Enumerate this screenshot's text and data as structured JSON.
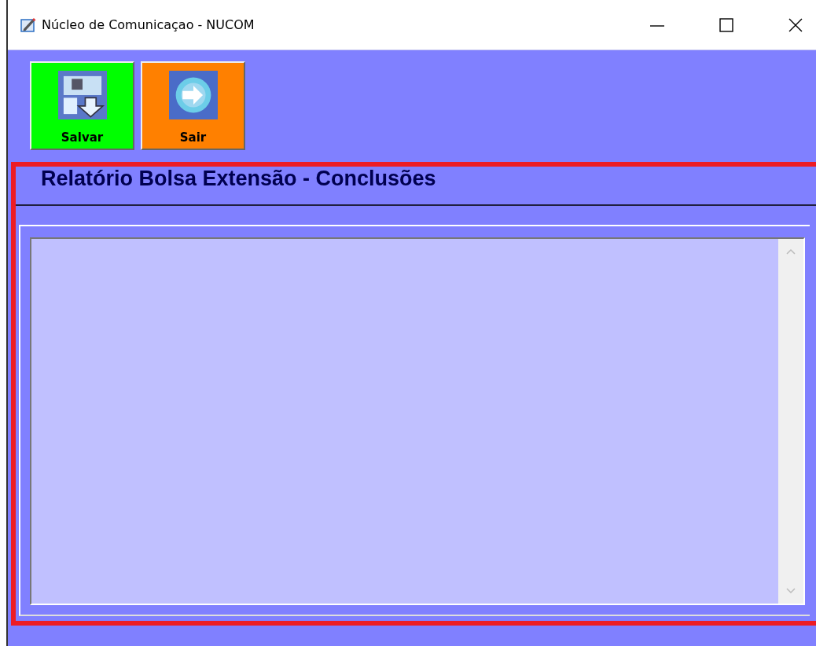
{
  "window": {
    "title": "Núcleo de Comunicaçao - NUCOM"
  },
  "toolbar": [
    {
      "label": "Salvar",
      "kind": "save",
      "color": "#00ff00"
    },
    {
      "label": "Sair",
      "kind": "exit",
      "color": "#ff8000"
    }
  ],
  "form": {
    "title": "Relatório Bolsa Extensão - Conclusões"
  }
}
